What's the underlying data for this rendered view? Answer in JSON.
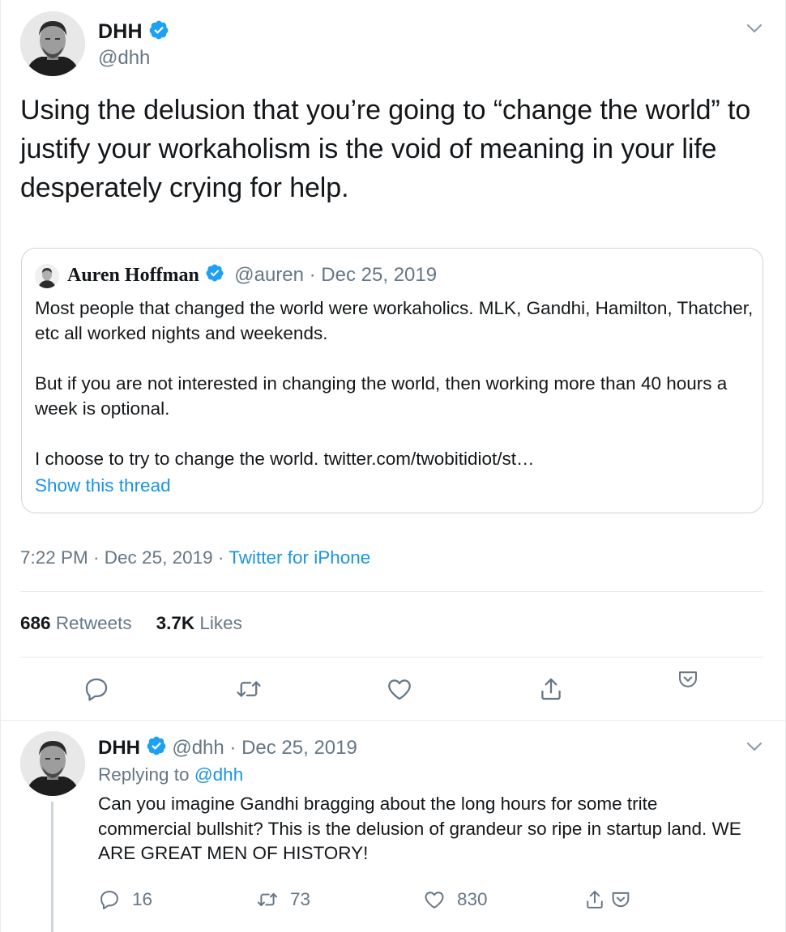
{
  "tweet": {
    "author_name": "DHH",
    "author_handle": "@dhh",
    "text": "Using the delusion that you’re going to “change the world” to justify your workaholism is the void of meaning in your life desperately crying for help.",
    "timestamp": "7:22 PM · Dec 25, 2019 · ",
    "source": "Twitter for iPhone",
    "retweets_count": "686",
    "retweets_label": "Retweets",
    "likes_count": "3.7K",
    "likes_label": "Likes"
  },
  "quote": {
    "author_name": "Auren Hoffman",
    "meta": "@auren · Dec 25, 2019",
    "paragraphs": [
      "Most people that changed the world were workaholics.  MLK, Gandhi, Hamilton, Thatcher, etc all worked nights and weekends.",
      "But if you are not interested in changing the world, then working more than 40 hours a week is optional.",
      "I choose to try to change the world. twitter.com/twobitidiot/st…"
    ],
    "show_thread": "Show this thread"
  },
  "reply": {
    "author_name": "DHH",
    "meta": " @dhh · Dec 25, 2019",
    "replying_prefix": "Replying to ",
    "replying_to": "@dhh",
    "text": "Can you imagine Gandhi bragging about the long hours for some trite commercial bullshit? This is the delusion of grandeur so ripe in startup land. WE ARE GREAT MEN OF HISTORY!",
    "reply_count": "16",
    "retweet_count": "73",
    "like_count": "830"
  },
  "icons": {
    "verified": "verified-badge-icon",
    "caret": "chevron-down-icon",
    "reply": "reply-icon",
    "retweet": "retweet-icon",
    "like": "heart-icon",
    "share": "share-icon",
    "save": "bookmark-pocket-icon"
  },
  "colors": {
    "text": "#14171a",
    "muted": "#657786",
    "link": "#1b95e0",
    "verified": "#1da1f2",
    "border": "#e6ecf0"
  }
}
